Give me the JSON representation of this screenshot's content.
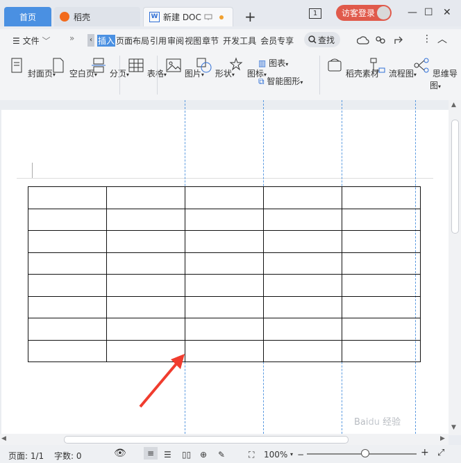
{
  "tabs": {
    "home": "首页",
    "daoke": "稻壳",
    "doc": "新建 DOC"
  },
  "titlebar": {
    "page_count_badge": "1",
    "login_label": "访客登录"
  },
  "menubar": {
    "file_label": "文件",
    "tabs": [
      "插入",
      "页面布局",
      "引用",
      "审阅",
      "视图",
      "章节",
      "开发工具",
      "会员专享"
    ],
    "active_tab": "插入",
    "search_label": "查找"
  },
  "ribbon": {
    "cover": "封面页",
    "blank": "空白页",
    "page_break": "分页",
    "table": "表格",
    "picture": "图片",
    "shape": "形状",
    "icon": "图标",
    "chart": "图表",
    "smart_art": "智能图形",
    "daoke_material": "稻壳素材",
    "flowchart": "流程图",
    "mindmap": "思维导图"
  },
  "table": {
    "rows": 8,
    "cols": 5
  },
  "statusbar": {
    "page_label": "页面: 1/1",
    "word_count": "字数: 0",
    "zoom": "100%"
  },
  "colors": {
    "accent": "#4a90e2",
    "login": "#e05a4b",
    "arrow": "#f03c2e"
  }
}
